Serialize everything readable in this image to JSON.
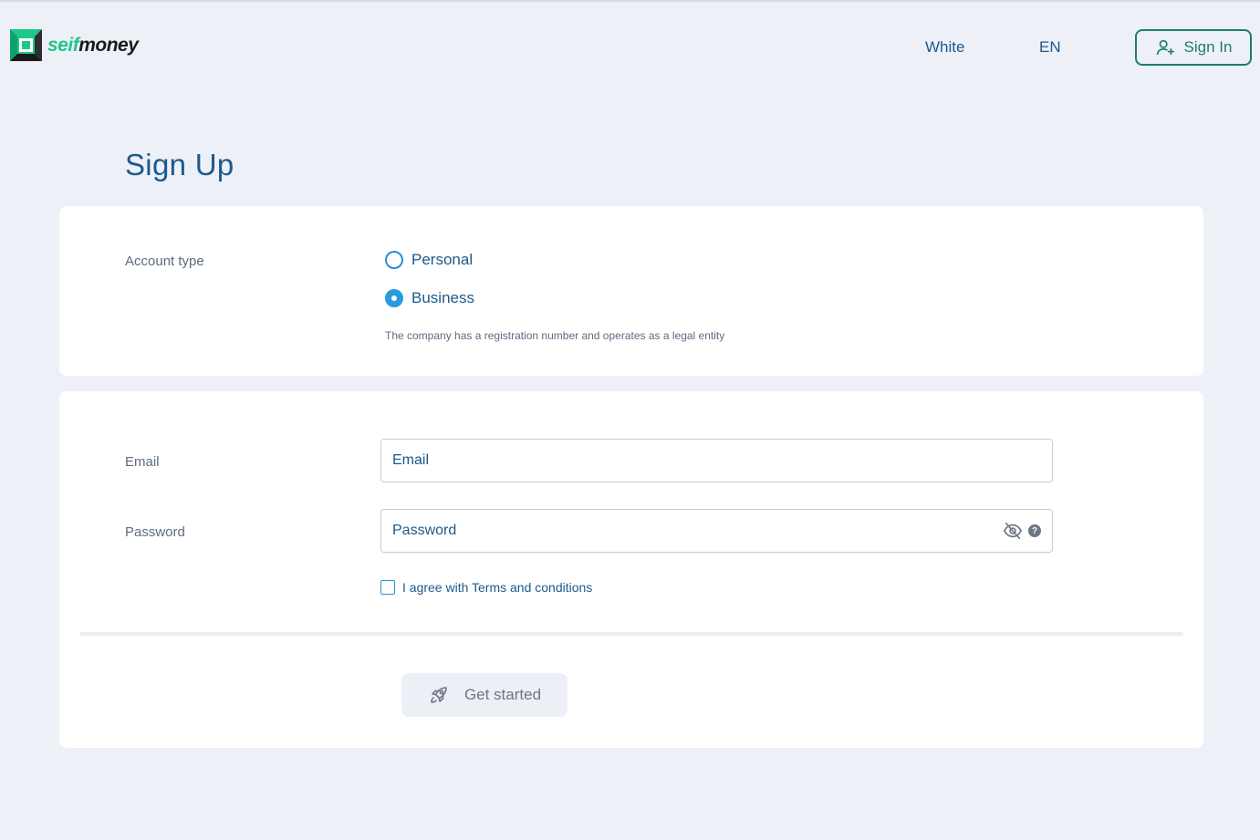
{
  "brand": {
    "name_part1": "seif",
    "name_part2": "money",
    "accent": "#1ec78a"
  },
  "header": {
    "theme_label": "White",
    "language_label": "EN",
    "signin_label": "Sign In",
    "signin_icon": "add-user-icon"
  },
  "page": {
    "title": "Sign Up"
  },
  "account_type": {
    "label": "Account type",
    "options": [
      {
        "label": "Personal",
        "selected": false
      },
      {
        "label": "Business",
        "selected": true
      }
    ],
    "hint": "The company has a registration number and operates as a legal entity"
  },
  "form": {
    "email_label": "Email",
    "email_placeholder": "Email",
    "password_label": "Password",
    "password_placeholder": "Password",
    "agree_label": "I agree with Terms and conditions",
    "agree_checked": false,
    "submit_label": "Get started",
    "submit_icon": "rocket-icon"
  },
  "colors": {
    "background": "#eef0f7",
    "primary_text": "#1b5a8c",
    "signin_border": "#1b7d6b",
    "radio_selected": "#2a9be0",
    "button_disabled_bg": "#eceff5"
  }
}
